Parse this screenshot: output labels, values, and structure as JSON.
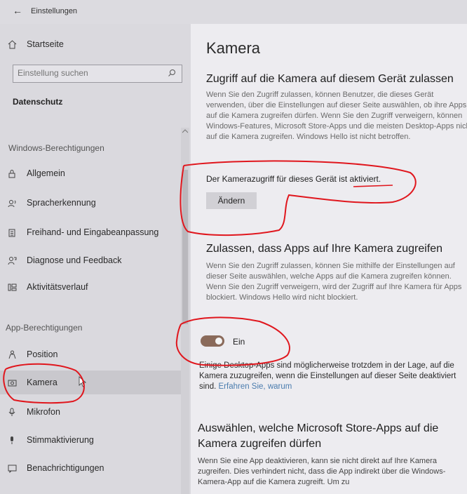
{
  "window": {
    "back_glyph": "←",
    "title": "Einstellungen"
  },
  "sidebar": {
    "home_label": "Startseite",
    "search_placeholder": "Einstellung suchen",
    "current_section": "Datenschutz",
    "windows_permissions_header": "Windows-Berechtigungen",
    "windows_items": [
      {
        "label": "Allgemein",
        "icon": "lock-icon"
      },
      {
        "label": "Spracherkennung",
        "icon": "speech-icon"
      },
      {
        "label": "Freihand- und Eingabeanpassung",
        "icon": "clipboard-icon"
      },
      {
        "label": "Diagnose und Feedback",
        "icon": "feedback-icon"
      },
      {
        "label": "Aktivitätsverlauf",
        "icon": "activity-history-icon"
      }
    ],
    "app_permissions_header": "App-Berechtigungen",
    "app_items": [
      {
        "label": "Position",
        "icon": "location-icon"
      },
      {
        "label": "Kamera",
        "icon": "camera-icon",
        "selected": true
      },
      {
        "label": "Mikrofon",
        "icon": "microphone-icon"
      },
      {
        "label": "Stimmaktivierung",
        "icon": "voice-activation-icon"
      },
      {
        "label": "Benachrichtigungen",
        "icon": "notifications-icon"
      }
    ]
  },
  "main": {
    "title": "Kamera",
    "device_access": {
      "heading": "Zugriff auf die Kamera auf diesem Gerät zulassen",
      "description": "Wenn Sie den Zugriff zulassen, können Benutzer, die dieses Gerät verwenden, über die Einstellungen auf dieser Seite auswählen, ob ihre Apps auf die Kamera zugreifen dürfen. Wenn Sie den Zugriff verweigern, können Windows-Features, Microsoft Store-Apps und die meisten Desktop-Apps nicht auf die Kamera zugreifen. Windows Hello ist nicht betroffen.",
      "status": "Der Kamerazugriff für dieses Gerät ist aktiviert.",
      "change_button": "Ändern"
    },
    "app_access": {
      "heading": "Zulassen, dass Apps auf Ihre Kamera zugreifen",
      "description": "Wenn Sie den Zugriff zulassen, können Sie mithilfe der Einstellungen auf dieser Seite auswählen, welche Apps auf die Kamera zugreifen können. Wenn Sie den Zugriff verweigern, wird der Zugriff auf Ihre Kamera für Apps blockiert. Windows Hello wird nicht blockiert.",
      "toggle_state": true,
      "toggle_label": "Ein",
      "desktop_note": "Einige Desktop-Apps sind möglicherweise trotzdem in der Lage, auf die Kamera zuzugreifen, wenn die Einstellungen auf dieser Seite deaktiviert sind.",
      "learn_link": "Erfahren Sie, warum"
    },
    "store_apps": {
      "heading_line1": "Auswählen, welche Microsoft Store-Apps auf die",
      "heading_line2": "Kamera zugreifen dürfen",
      "description": "Wenn Sie eine App deaktivieren, kann sie nicht direkt auf Ihre Kamera zugreifen. Dies verhindert nicht, dass die App indirekt über die Windows-Kamera-App auf die Kamera zugreift. Um zu"
    }
  },
  "colors": {
    "annotation_red": "#e0161d",
    "toggle_on": "#8a6a5a",
    "link": "#4a7cae"
  }
}
